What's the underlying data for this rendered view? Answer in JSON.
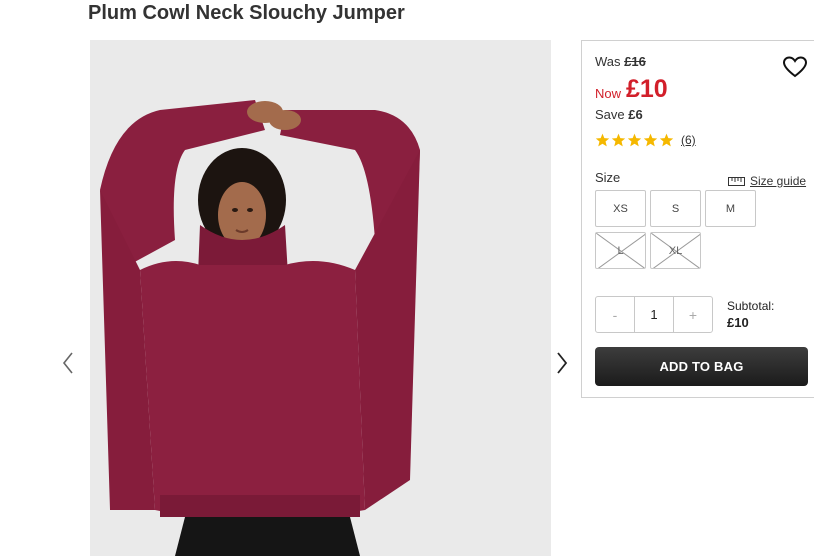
{
  "product": {
    "title": "Plum Cowl Neck Slouchy Jumper",
    "image_icon": "product-photo-jumper"
  },
  "pricing": {
    "was_label": "Was",
    "was_price": "£16",
    "now_label": "Now",
    "now_price": "£10",
    "save_label": "Save",
    "save_amount": "£6",
    "accent_color": "#d21f2a"
  },
  "rating": {
    "stars": 5,
    "review_count": "(6)",
    "star_color": "#f5b800"
  },
  "sizes": {
    "label": "Size",
    "guide_label": "Size guide",
    "options": [
      {
        "label": "XS",
        "available": true
      },
      {
        "label": "S",
        "available": true
      },
      {
        "label": "M",
        "available": true
      },
      {
        "label": "L",
        "available": false
      },
      {
        "label": "XL",
        "available": false
      }
    ]
  },
  "quantity": {
    "minus": "-",
    "value": "1",
    "plus": "+"
  },
  "subtotal": {
    "label": "Subtotal:",
    "value": "£10"
  },
  "actions": {
    "add_to_bag": "ADD TO BAG"
  },
  "icons": {
    "wishlist": "heart-icon",
    "size_guide": "ruler-icon",
    "prev": "chevron-left-icon",
    "next": "chevron-right-icon"
  }
}
